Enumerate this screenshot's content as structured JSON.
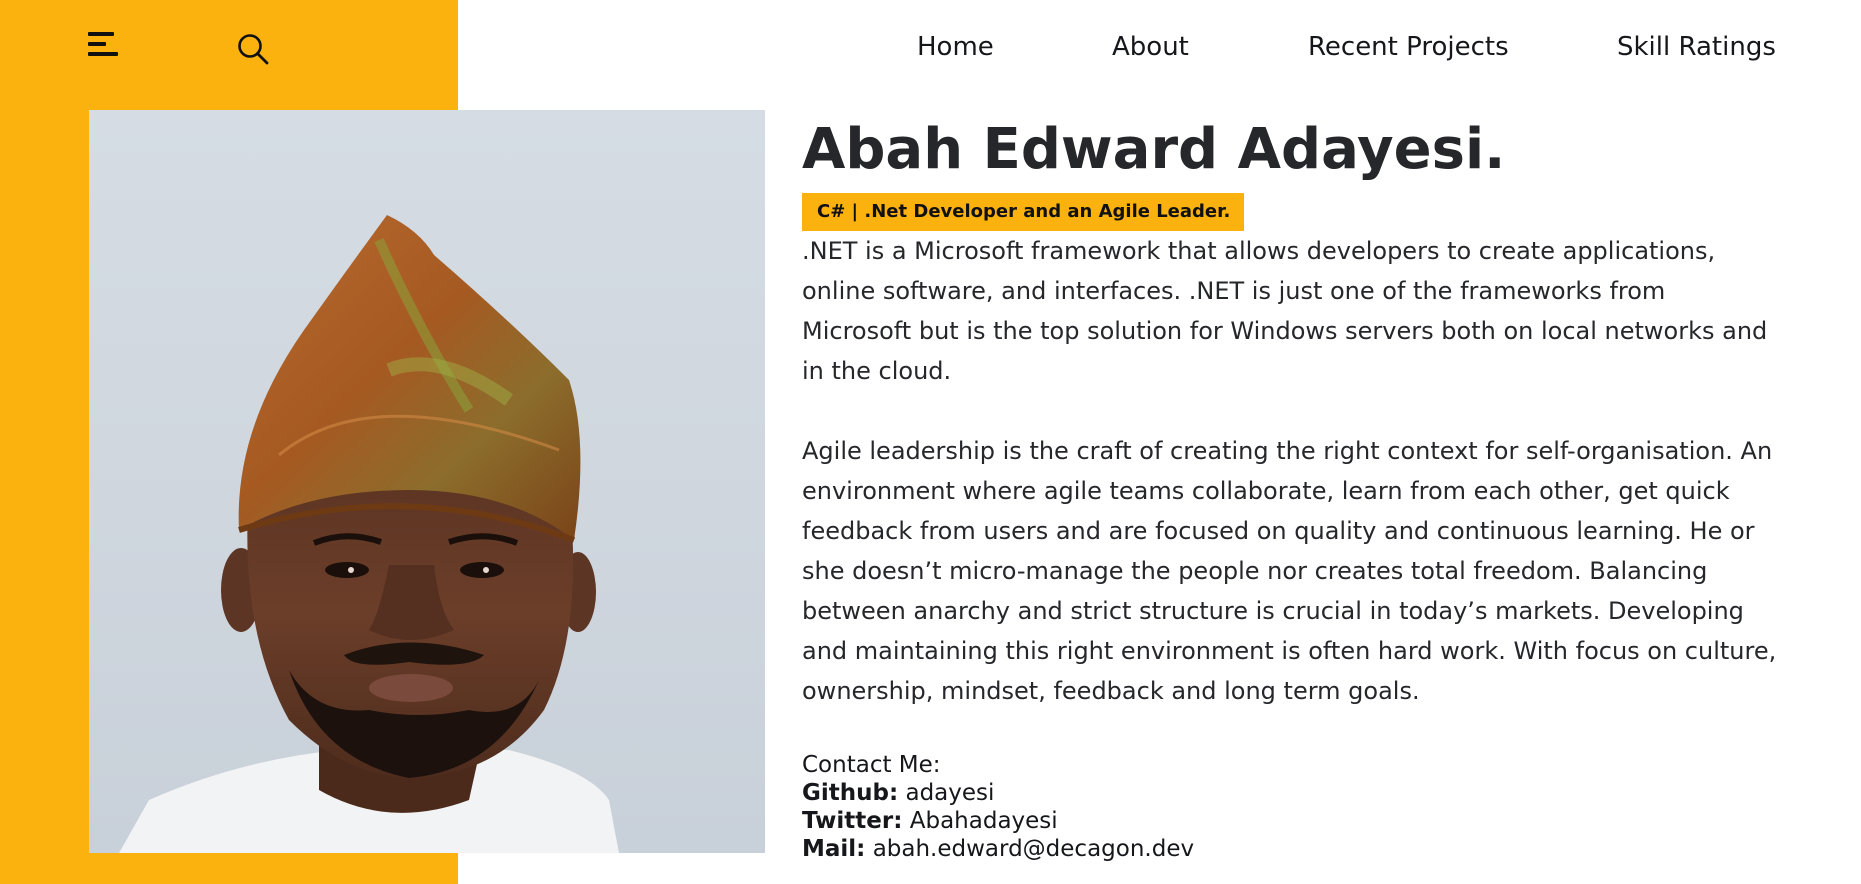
{
  "header": {
    "menu_icon": "hamburger-menu-icon",
    "search_icon": "search-icon",
    "nav": [
      {
        "label": "Home"
      },
      {
        "label": "About"
      },
      {
        "label": "Recent Projects"
      },
      {
        "label": "Skill Ratings"
      }
    ]
  },
  "profile": {
    "name": "Abah Edward Adayesi.",
    "tagline": "C# | .Net Developer and an Agile Leader.",
    "paragraph_1": ".NET is a Microsoft framework that allows developers to create applications, online software, and interfaces. .NET is just one of the frameworks from Microsoft but is the top solution for Windows servers both on local networks and in the cloud.",
    "paragraph_2": "Agile leadership is the craft of creating the right context for self-organisation. An environment where agile teams collaborate, learn from each other, get quick feedback from users and are focused on quality and continuous learning. He or she doesn’t micro-manage the people nor creates total freedom. Balancing between anarchy and strict structure is crucial in today’s markets. Developing and maintaining this right environment is often hard work. With focus on culture, ownership, mindset, feedback and long term goals."
  },
  "contact": {
    "heading": "Contact Me:",
    "github_label": "Github:",
    "github_value": "adayesi",
    "twitter_label": "Twitter:",
    "twitter_value": "Abahadayesi",
    "mail_label": "Mail:",
    "mail_value": "abah.edward@decagon.dev"
  },
  "colors": {
    "accent": "#fbb20f",
    "text": "#26272b",
    "background": "#ffffff"
  }
}
